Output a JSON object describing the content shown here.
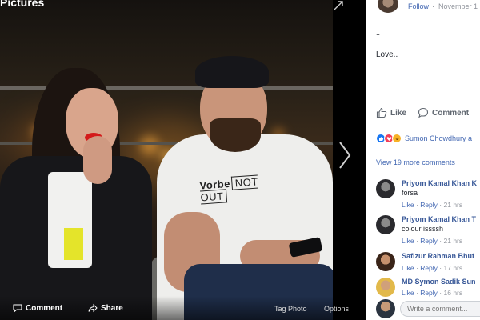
{
  "viewer": {
    "title": "Pictures",
    "tee_text_left": "Vorbe",
    "tee_text_boxed": "NOT OUT",
    "bottom_bar": {
      "comment_label": "Comment",
      "share_label": "Share",
      "tag_photo_label": "Tag Photo",
      "options_label": "Options"
    }
  },
  "post": {
    "follow_label": "Follow",
    "separator": "·",
    "date": "November 1",
    "dots": "..",
    "text": "Love..",
    "actions": {
      "like_label": "Like",
      "comment_label": "Comment"
    },
    "reactions_text": "Sumon Chowdhury a",
    "view_more": "View 19 more comments"
  },
  "comments": [
    {
      "name": "Priyom Kamal Khan K",
      "text": "forsa",
      "like": "Like",
      "reply": "Reply",
      "sep": "·",
      "time": "21 hrs"
    },
    {
      "name": "Priyom Kamal Khan T",
      "text": "colour issssh",
      "like": "Like",
      "reply": "Reply",
      "sep": "·",
      "time": "21 hrs"
    },
    {
      "name": "Safizur Rahman Bhut",
      "text": "",
      "like": "Like",
      "reply": "Reply",
      "sep": "·",
      "time": "17 hrs"
    },
    {
      "name": "MD Symon Sadik Sun",
      "text": "",
      "like": "Like",
      "reply": "Reply",
      "sep": "·",
      "time": "16 hrs"
    }
  ],
  "write_comment": {
    "placeholder": "Write a comment..."
  },
  "colors": {
    "link_blue": "#4267b2",
    "name_blue": "#385898",
    "meta_grey": "#90949c",
    "like_reaction": "#1877f2",
    "love_reaction": "#f33e58",
    "haha_reaction": "#f7b125"
  }
}
